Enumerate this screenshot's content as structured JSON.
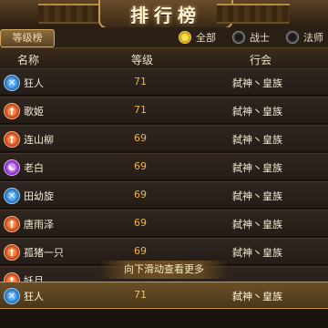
{
  "title": "排行榜",
  "filter": {
    "rank_tab": "等级榜",
    "options": [
      {
        "label": "全部",
        "selected": true
      },
      {
        "label": "战士",
        "selected": false
      },
      {
        "label": "法师",
        "selected": false
      }
    ]
  },
  "columns": {
    "name": "名称",
    "level": "等级",
    "guild": "行会"
  },
  "rows": [
    {
      "name": "狂人",
      "level": "71",
      "guild": "弑神丶皇族",
      "class_icon": "berserker-icon"
    },
    {
      "name": "歌姬",
      "level": "71",
      "guild": "弑神丶皇族",
      "class_icon": "warrior-icon"
    },
    {
      "name": "连山柳",
      "level": "69",
      "guild": "弑神丶皇族",
      "class_icon": "warrior-icon"
    },
    {
      "name": "老白",
      "level": "69",
      "guild": "弑神丶皇族",
      "class_icon": "mage-icon"
    },
    {
      "name": "田幼旋",
      "level": "69",
      "guild": "弑神丶皇族",
      "class_icon": "berserker-icon"
    },
    {
      "name": "唐雨泽",
      "level": "69",
      "guild": "弑神丶皇族",
      "class_icon": "warrior-icon"
    },
    {
      "name": "孤猪一只",
      "level": "69",
      "guild": "弑神丶皇族",
      "class_icon": "warrior-icon"
    },
    {
      "name": "妖月",
      "level": "",
      "guild": "",
      "class_icon": "warrior-icon"
    }
  ],
  "scroll_hint": "向下滑动查看更多",
  "self_row": {
    "name": "狂人",
    "level": "71",
    "guild": "弑神丶皇族",
    "class_icon": "berserker-icon"
  },
  "colors": {
    "accent": "#f1b34a",
    "selected_radio": "#ffe14a",
    "self_row": "#6a5026"
  }
}
